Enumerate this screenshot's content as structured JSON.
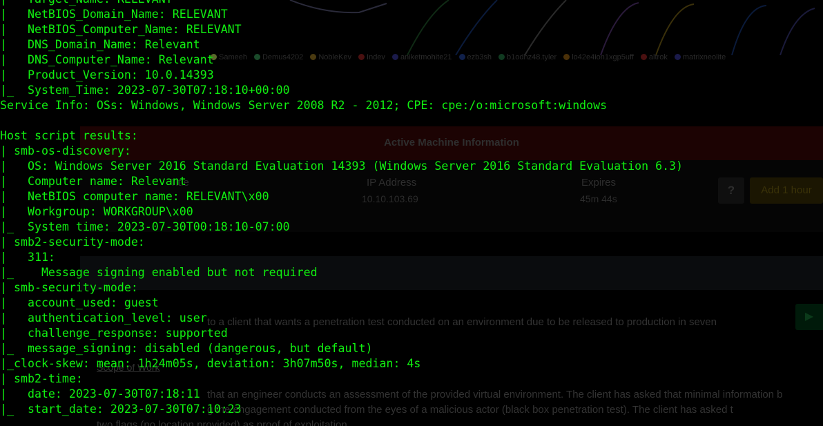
{
  "terminal": {
    "lines": [
      "|   Target_Name: RELEVANT",
      "|   NetBIOS_Domain_Name: RELEVANT",
      "|   NetBIOS_Computer_Name: RELEVANT",
      "|   DNS_Domain_Name: Relevant",
      "|   DNS_Computer_Name: Relevant",
      "|   Product_Version: 10.0.14393",
      "|_  System_Time: 2023-07-30T07:18:10+00:00",
      "Service Info: OSs: Windows, Windows Server 2008 R2 - 2012; CPE: cpe:/o:microsoft:windows",
      "",
      "Host script results:",
      "| smb-os-discovery:",
      "|   OS: Windows Server 2016 Standard Evaluation 14393 (Windows Server 2016 Standard Evaluation 6.3)",
      "|   Computer name: Relevant",
      "|   NetBIOS computer name: RELEVANT\\x00",
      "|   Workgroup: WORKGROUP\\x00",
      "|_  System time: 2023-07-30T00:18:10-07:00",
      "| smb2-security-mode:",
      "|   311:",
      "|_    Message signing enabled but not required",
      "| smb-security-mode:",
      "|   account_used: guest",
      "|   authentication_level: user",
      "|   challenge_response: supported",
      "|_  message_signing: disabled (dangerous, but default)",
      "|_clock-skew: mean: 1h24m05s, deviation: 3h07m50s, median: 4s",
      "| smb2-time:",
      "|   date: 2023-07-30T07:18:11",
      "|_  start_date: 2023-07-30T07:10:23"
    ],
    "text_color": "#10f010"
  },
  "background_page": {
    "legend": [
      {
        "name": "Sameeh",
        "color": "#5a6a2a"
      },
      {
        "name": "Demus4202",
        "color": "#1a4a2a"
      },
      {
        "name": "NobleKev",
        "color": "#4a3a10"
      },
      {
        "name": "Indev",
        "color": "#4a1010"
      },
      {
        "name": "aniketmohite21",
        "color": "#1a1a4a"
      },
      {
        "name": "ezb3sh",
        "color": "#10204a"
      },
      {
        "name": "b1odhz48.tyler",
        "color": "#103a20"
      },
      {
        "name": "lo42e4ion1xgp5uff",
        "color": "#4a3008"
      },
      {
        "name": "altrok",
        "color": "#4a1010"
      },
      {
        "name": "matrixneolite",
        "color": "#1a1a4a"
      }
    ],
    "active_machine": {
      "title": "Active Machine Information",
      "col_title": "Title",
      "col_ip": "IP Address",
      "col_expires": "Expires",
      "ip_value": "10.10.103.69",
      "expires_value": "45m 44s",
      "help_label": "?",
      "add_hour_label": "Add 1 hour"
    },
    "task_text_1": "to a client that wants a penetration test conducted on an environment due to be released to production in seven",
    "scope_label": "Scope of Work",
    "task_text_2": "that an engineer conducts an assessment of the provided virtual environment. The client has asked that minimal information b",
    "task_text_3": "g the engagement conducted from the eyes of a malicious actor (black box penetration test).  The client has asked t",
    "task_text_4": "two flags (no location provided) as proof of exploitation",
    "play_icon": "play-icon"
  }
}
